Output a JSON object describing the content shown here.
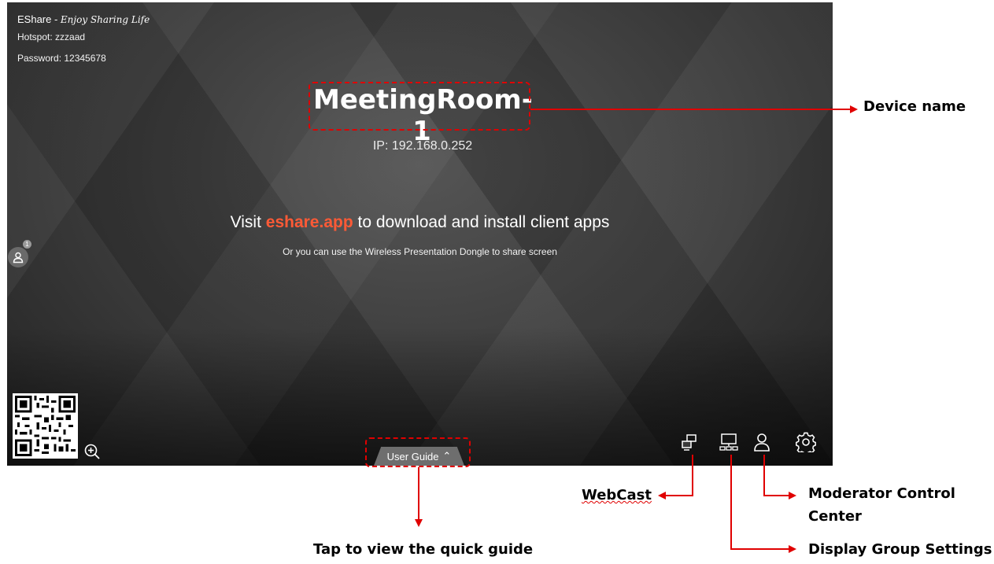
{
  "screen": {
    "brand": "EShare - ",
    "brand_tagline": "Enjoy Sharing Life",
    "hotspot": "Hotspot: zzzaad",
    "password": "Password: 12345678",
    "device_name": "MeetingRoom-1",
    "ip": "IP: 192.168.0.252",
    "visit_prefix": "Visit ",
    "visit_link": "eshare.app",
    "visit_suffix": " to download and install client apps",
    "dongle_text": "Or you can use the Wireless Presentation Dongle to share screen",
    "user_count": "1",
    "user_guide_label": "User Guide",
    "icons": [
      "webcast-icon",
      "display-group-icon",
      "moderator-icon",
      "settings-icon",
      "zoom-in-icon",
      "user-icon",
      "qr-code"
    ]
  },
  "annotations": {
    "device_name": "Device name",
    "webcast": "WebCast",
    "moderator_line1": "Moderator Control",
    "moderator_line2": "Center",
    "display_group": "Display Group Settings",
    "quick_guide": "Tap to view the quick guide"
  },
  "colors": {
    "accent_link": "#ff5a36",
    "annotation": "#e00000"
  }
}
